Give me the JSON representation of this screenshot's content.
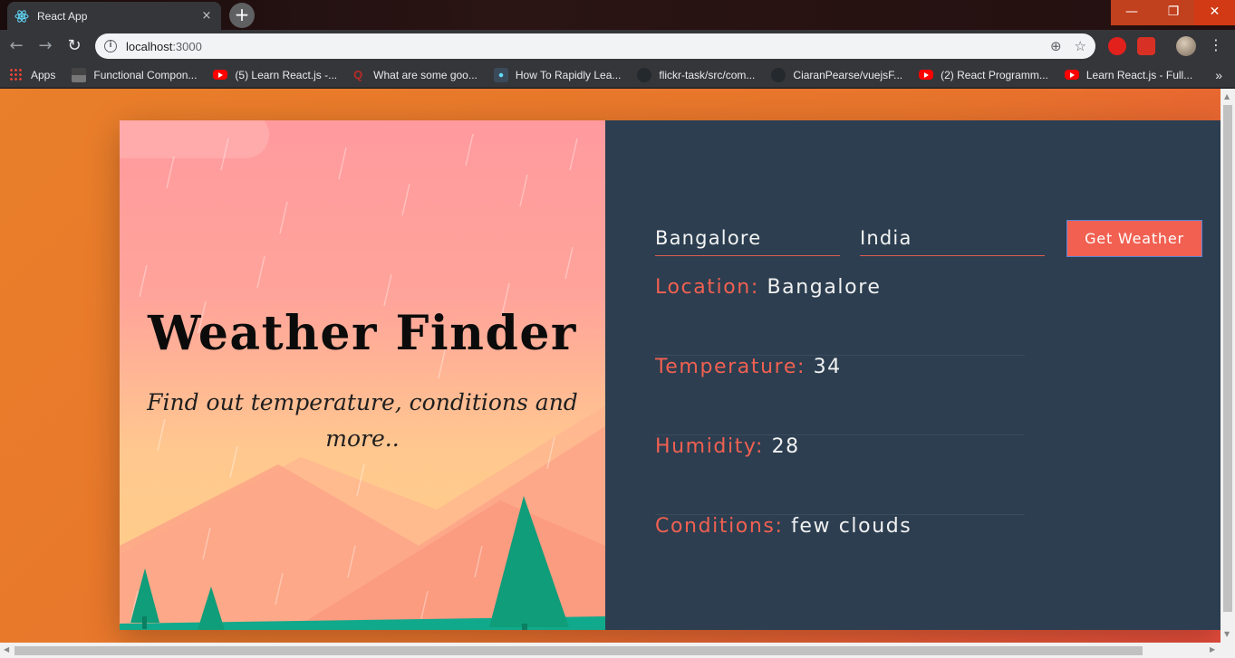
{
  "browser": {
    "tab_title": "React App",
    "tab_close": "×",
    "new_tab": "+",
    "url_host": "localhost",
    "url_port": ":3000",
    "bookmarks": [
      {
        "label": "Apps",
        "icon": "apps-grid-icon"
      },
      {
        "label": "Functional Compon...",
        "icon": "page-icon"
      },
      {
        "label": "(5) Learn React.js -...",
        "icon": "youtube-icon"
      },
      {
        "label": "What are some goo...",
        "icon": "quora-icon"
      },
      {
        "label": "How To Rapidly Lea...",
        "icon": "react-icon"
      },
      {
        "label": "flickr-task/src/com...",
        "icon": "github-icon"
      },
      {
        "label": "CiaranPearse/vuejsF...",
        "icon": "github-icon"
      },
      {
        "label": "(2) React Programm...",
        "icon": "youtube-icon"
      },
      {
        "label": "Learn React.js - Full...",
        "icon": "youtube-icon"
      }
    ],
    "bookmarks_overflow": "»"
  },
  "hero": {
    "title": "Weather Finder",
    "subtitle": "Find out temperature, conditions and more.."
  },
  "form": {
    "city_value": "Bangalore",
    "country_value": "India",
    "button_label": "Get Weather"
  },
  "weather": {
    "location_label": "Location:",
    "location_value": "Bangalore",
    "temperature_label": "Temperature:",
    "temperature_value": "34",
    "humidity_label": "Humidity:",
    "humidity_value": "28",
    "conditions_label": "Conditions:",
    "conditions_value": "few clouds"
  },
  "colors": {
    "page_bg_start": "#e97f2a",
    "page_bg_end": "#e74c3c",
    "panel_bg": "#2c3e50",
    "accent": "#f16051",
    "tree": "#0f9d7a"
  }
}
